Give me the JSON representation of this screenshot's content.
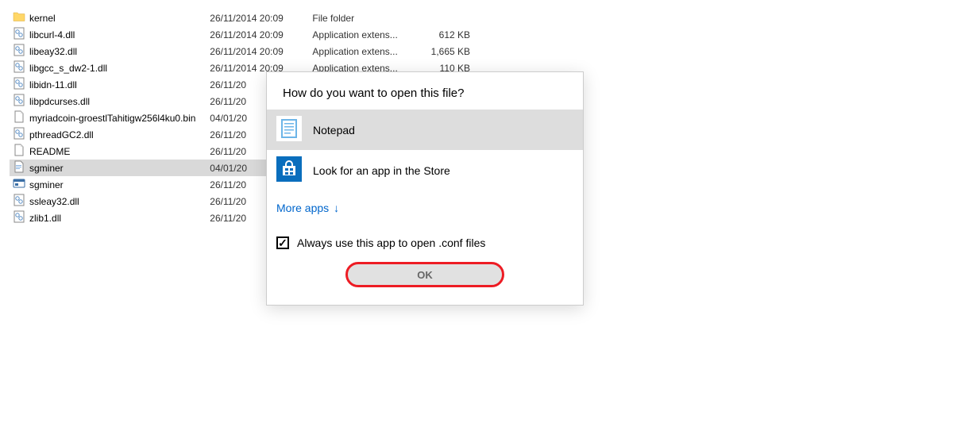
{
  "files": [
    {
      "name": "kernel",
      "date": "26/11/2014 20:09",
      "type": "File folder",
      "size": "",
      "icon": "folder",
      "selected": false
    },
    {
      "name": "libcurl-4.dll",
      "date": "26/11/2014 20:09",
      "type": "Application extens...",
      "size": "612 KB",
      "icon": "dll",
      "selected": false
    },
    {
      "name": "libeay32.dll",
      "date": "26/11/2014 20:09",
      "type": "Application extens...",
      "size": "1,665 KB",
      "icon": "dll",
      "selected": false
    },
    {
      "name": "libgcc_s_dw2-1.dll",
      "date": "26/11/2014 20:09",
      "type": "Application extens...",
      "size": "110 KB",
      "icon": "dll",
      "selected": false
    },
    {
      "name": "libidn-11.dll",
      "date": "26/11/20",
      "type": "",
      "size": "",
      "icon": "dll",
      "selected": false
    },
    {
      "name": "libpdcurses.dll",
      "date": "26/11/20",
      "type": "",
      "size": "",
      "icon": "dll",
      "selected": false
    },
    {
      "name": "myriadcoin-groestlTahitigw256l4ku0.bin",
      "date": "04/01/20",
      "type": "",
      "size": "",
      "icon": "file",
      "selected": false
    },
    {
      "name": "pthreadGC2.dll",
      "date": "26/11/20",
      "type": "",
      "size": "",
      "icon": "dll",
      "selected": false
    },
    {
      "name": "README",
      "date": "26/11/20",
      "type": "",
      "size": "",
      "icon": "file",
      "selected": false
    },
    {
      "name": "sgminer",
      "date": "04/01/20",
      "type": "",
      "size": "",
      "icon": "conf",
      "selected": true
    },
    {
      "name": "sgminer",
      "date": "26/11/20",
      "type": "",
      "size": "",
      "icon": "exe",
      "selected": false
    },
    {
      "name": "ssleay32.dll",
      "date": "26/11/20",
      "type": "",
      "size": "",
      "icon": "dll",
      "selected": false
    },
    {
      "name": "zlib1.dll",
      "date": "26/11/20",
      "type": "",
      "size": "",
      "icon": "dll",
      "selected": false
    }
  ],
  "dialog": {
    "title": "How do you want to open this file?",
    "options": [
      {
        "label": "Notepad",
        "icon": "notepad",
        "selected": true
      },
      {
        "label": "Look for an app in the Store",
        "icon": "store",
        "selected": false
      }
    ],
    "more_apps": "More apps",
    "always_label": "Always use this app to open .conf files",
    "always_checked": true,
    "ok_label": "OK"
  }
}
